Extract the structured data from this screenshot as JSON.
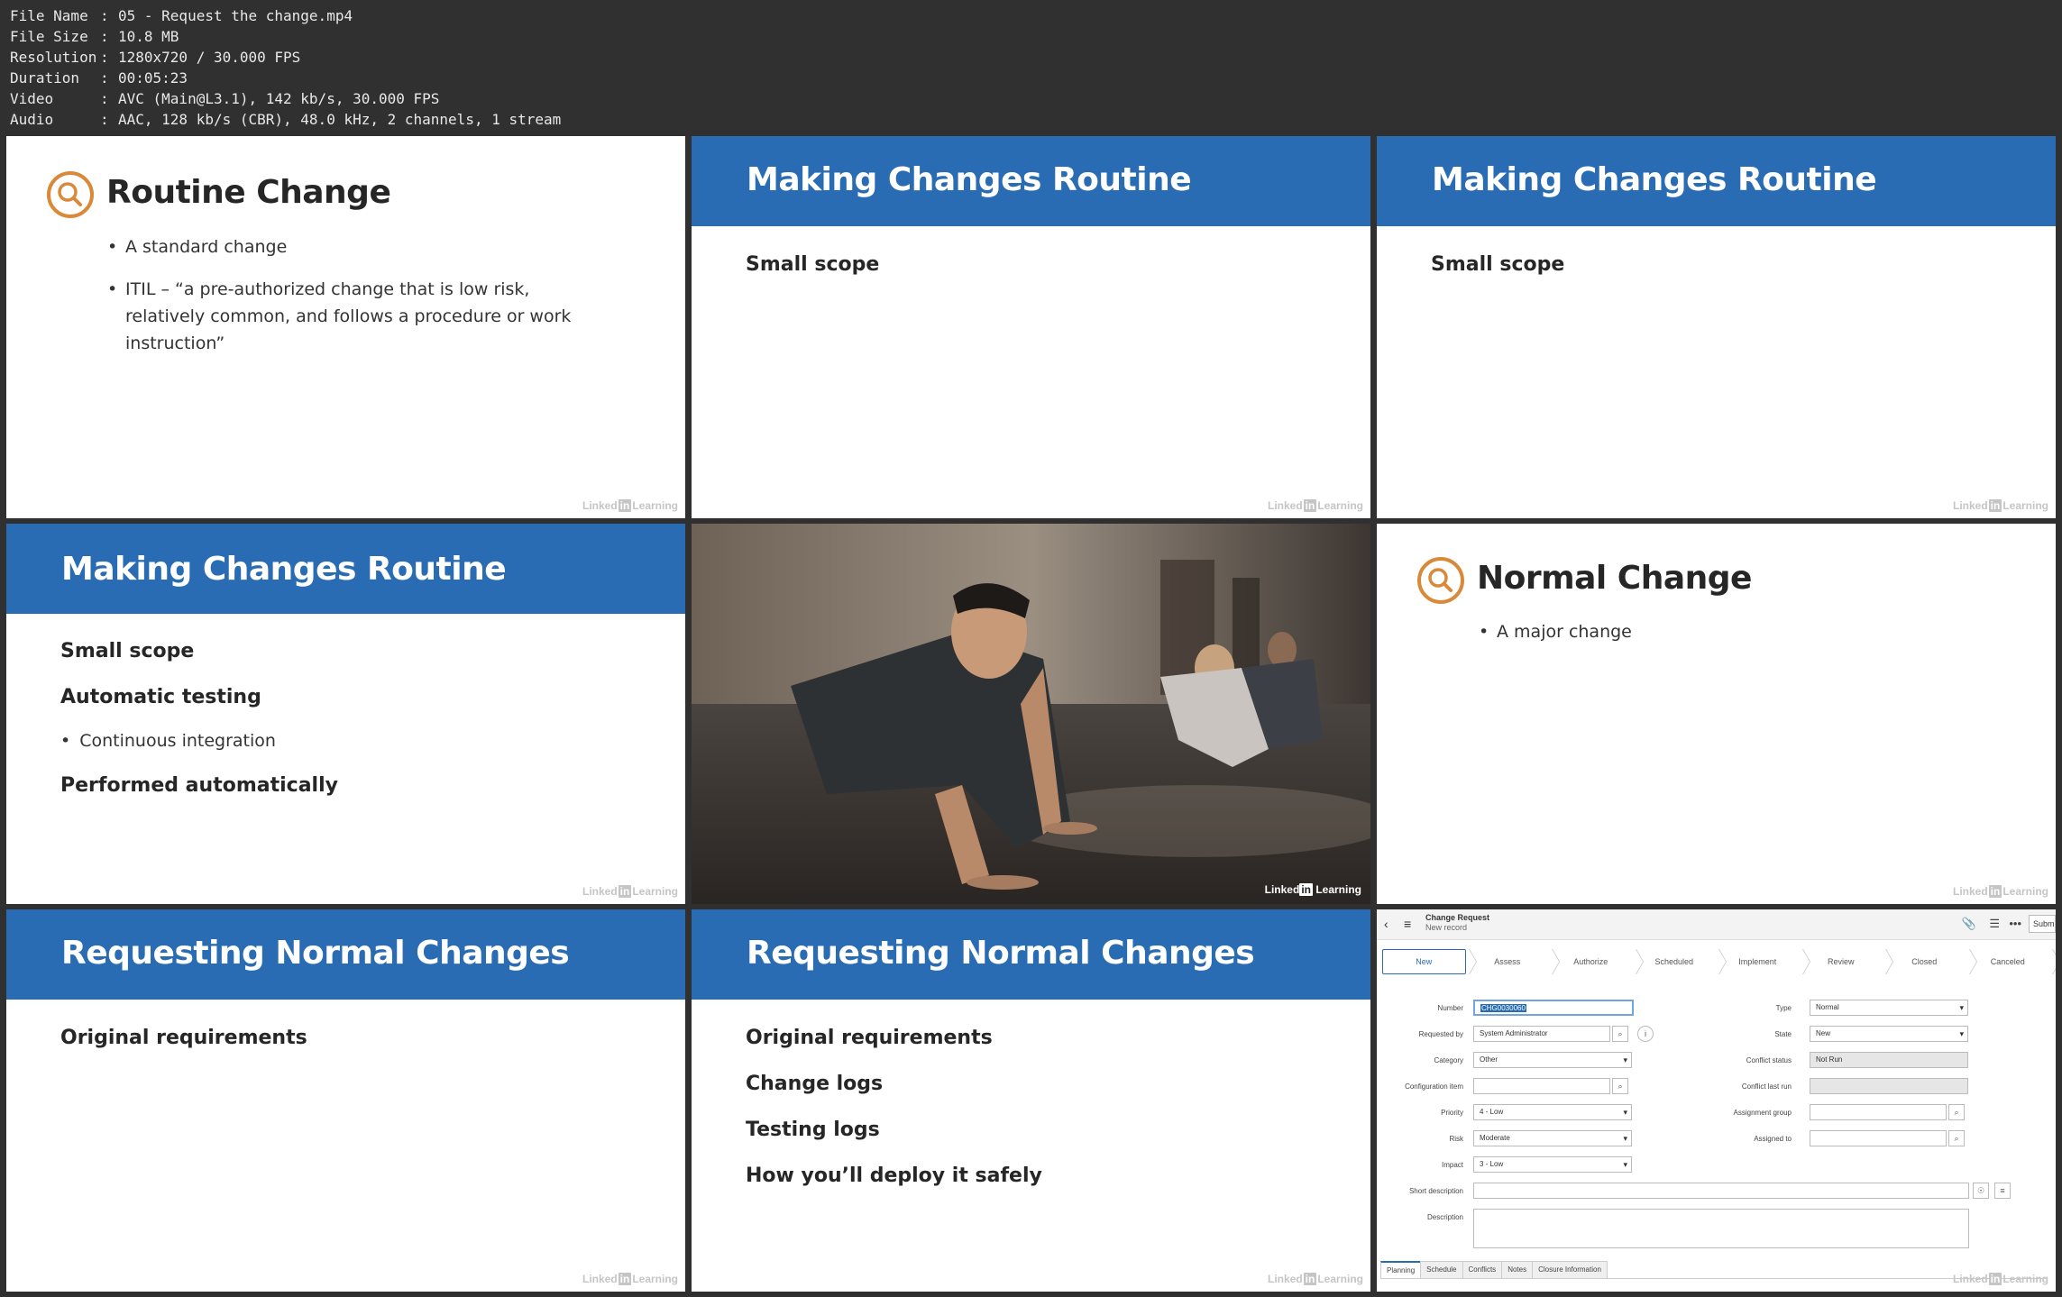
{
  "file_info": [
    {
      "key": "File Name",
      "value": "05 - Request the change.mp4"
    },
    {
      "key": "File Size",
      "value": "10.8 MB"
    },
    {
      "key": "Resolution",
      "value": "1280x720 / 30.000 FPS"
    },
    {
      "key": "Duration",
      "value": "00:05:23"
    },
    {
      "key": "Video",
      "value": "AVC (Main@L3.1), 142 kb/s, 30.000 FPS"
    },
    {
      "key": "Audio",
      "value": "AAC, 128 kb/s (CBR), 48.0 kHz, 2 channels, 1 stream"
    }
  ],
  "watermark": {
    "pre": "Linked",
    "in": "in",
    "post": "Learning"
  },
  "slides": {
    "s1": {
      "title": "Routine Change",
      "bullets": [
        "A standard change",
        "ITIL – “a pre-authorized change that is low risk, relatively common, and follows a procedure or work instruction”"
      ]
    },
    "s2": {
      "title": "Making Changes Routine",
      "points": [
        "Small scope"
      ]
    },
    "s3": {
      "title": "Making Changes Routine",
      "points": [
        "Small scope"
      ]
    },
    "s4": {
      "title": "Making Changes Routine",
      "points": [
        "Small scope",
        "Automatic testing"
      ],
      "sub": "Continuous integration",
      "last": "Performed automatically"
    },
    "s6": {
      "title": "Normal Change",
      "bullets": [
        "A major change"
      ]
    },
    "s7": {
      "title": "Requesting Normal Changes",
      "points": [
        "Original requirements"
      ]
    },
    "s8": {
      "title": "Requesting Normal Changes",
      "points": [
        "Original requirements",
        "Change logs",
        "Testing logs",
        "How you’ll deploy it safely"
      ]
    }
  },
  "form": {
    "title": "Change Request",
    "subtitle": "New record",
    "submit": "Subm",
    "stages": [
      "New",
      "Assess",
      "Authorize",
      "Scheduled",
      "Implement",
      "Review",
      "Closed",
      "Canceled"
    ],
    "left_fields": [
      {
        "label": "Number",
        "value": "CHG0030060"
      },
      {
        "label": "Requested by",
        "value": "System Administrator"
      },
      {
        "label": "Category",
        "value": "Other"
      },
      {
        "label": "Configuration item",
        "value": ""
      },
      {
        "label": "Priority",
        "value": "4 - Low"
      },
      {
        "label": "Risk",
        "value": "Moderate"
      },
      {
        "label": "Impact",
        "value": "3 - Low"
      }
    ],
    "right_fields": [
      {
        "label": "Type",
        "value": "Normal"
      },
      {
        "label": "State",
        "value": "New"
      },
      {
        "label": "Conflict status",
        "value": "Not Run"
      },
      {
        "label": "Conflict last run",
        "value": ""
      },
      {
        "label": "Assignment group",
        "value": ""
      },
      {
        "label": "Assigned to",
        "value": ""
      }
    ],
    "short_description_label": "Short description",
    "description_label": "Description",
    "tabs": [
      "Planning",
      "Schedule",
      "Conflicts",
      "Notes",
      "Closure Information"
    ]
  },
  "colors": {
    "banner": "#2a6cb3",
    "icon": "#d9893a",
    "background": "#303030"
  }
}
